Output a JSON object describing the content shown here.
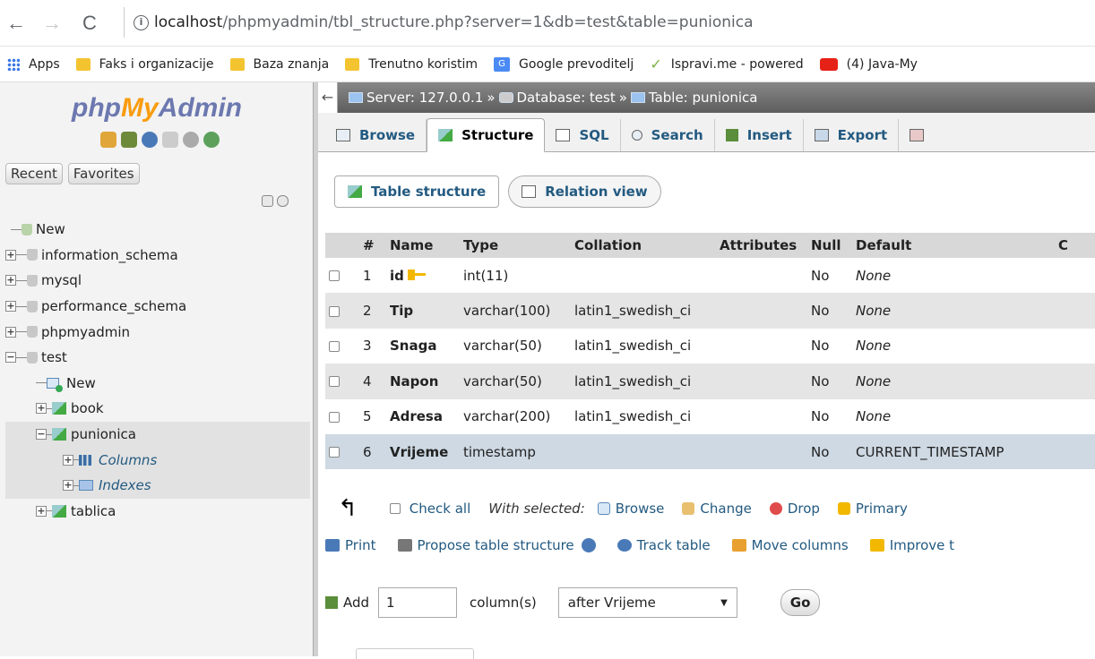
{
  "browser": {
    "url_host": "localhost",
    "url_path": "/phpmyadmin/tbl_structure.php?server=1&db=test&table=punionica",
    "bookmarks": [
      "Apps",
      "Faks i organizacije",
      "Baza znanja",
      "Trenutno koristim",
      "Google prevoditelj",
      "Ispravi.me - powered",
      "(4) Java-My"
    ]
  },
  "sidebar": {
    "logo_php": "php",
    "logo_my": "My",
    "logo_admin": "Admin",
    "recent_label": "Recent",
    "favorites_label": "Favorites",
    "tree": {
      "new": "New",
      "dbs": [
        "information_schema",
        "mysql",
        "performance_schema",
        "phpmyadmin"
      ],
      "test": "test",
      "test_new": "New",
      "book": "book",
      "punionica": "punionica",
      "columns": "Columns",
      "indexes": "Indexes",
      "tablica": "tablica"
    }
  },
  "breadcrumb": {
    "server": "Server: 127.0.0.1",
    "database": "Database: test",
    "table": "Table: punionica",
    "sep": "»"
  },
  "tabs": [
    "Browse",
    "Structure",
    "SQL",
    "Search",
    "Insert",
    "Export"
  ],
  "subtabs": {
    "table_structure": "Table structure",
    "relation_view": "Relation view"
  },
  "table": {
    "headers": [
      "#",
      "Name",
      "Type",
      "Collation",
      "Attributes",
      "Null",
      "Default",
      "C"
    ],
    "rows": [
      {
        "num": "1",
        "name": "id",
        "type": "int(11)",
        "collation": "",
        "null": "No",
        "default": "None"
      },
      {
        "num": "2",
        "name": "Tip",
        "type": "varchar(100)",
        "collation": "latin1_swedish_ci",
        "null": "No",
        "default": "None"
      },
      {
        "num": "3",
        "name": "Snaga",
        "type": "varchar(50)",
        "collation": "latin1_swedish_ci",
        "null": "No",
        "default": "None"
      },
      {
        "num": "4",
        "name": "Napon",
        "type": "varchar(50)",
        "collation": "latin1_swedish_ci",
        "null": "No",
        "default": "None"
      },
      {
        "num": "5",
        "name": "Adresa",
        "type": "varchar(200)",
        "collation": "latin1_swedish_ci",
        "null": "No",
        "default": "None"
      },
      {
        "num": "6",
        "name": "Vrijeme",
        "type": "timestamp",
        "collation": "",
        "null": "No",
        "default": "CURRENT_TIMESTAMP"
      }
    ]
  },
  "actions": {
    "check_all": "Check all",
    "with_selected": "With selected:",
    "browse": "Browse",
    "change": "Change",
    "drop": "Drop",
    "primary": "Primary"
  },
  "bottom_links": {
    "print": "Print",
    "propose": "Propose table structure",
    "track": "Track table",
    "move": "Move columns",
    "improve": "Improve t"
  },
  "add_column": {
    "add_label": "Add",
    "count": "1",
    "columns_label": "column(s)",
    "position": "after Vrijeme",
    "go": "Go"
  }
}
